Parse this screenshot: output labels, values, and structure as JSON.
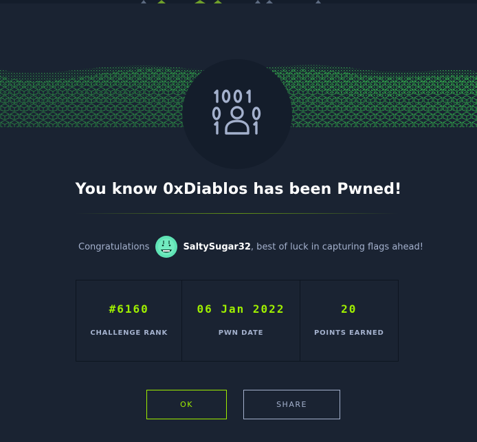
{
  "hero": {
    "title": "You know 0xDiablos has been Pwned!"
  },
  "congrats": {
    "prefix": "Congratulations",
    "username": "SaltySugar32",
    "suffix": ", best of luck in capturing flags ahead!"
  },
  "stats": [
    {
      "value": "#6160",
      "label": "CHALLENGE RANK"
    },
    {
      "value": "06 Jan 2022",
      "label": "PWN DATE"
    },
    {
      "value": "20",
      "label": "POINTS EARNED"
    }
  ],
  "buttons": {
    "ok": "OK",
    "share": "SHARE"
  },
  "colors": {
    "background": "#1a2332",
    "accent": "#9fef00",
    "muted": "#a4b1cd",
    "panel": "#141d2b"
  },
  "icons": {
    "badge": "binary-user-icon",
    "avatar": "smiley-avatar-icon"
  }
}
